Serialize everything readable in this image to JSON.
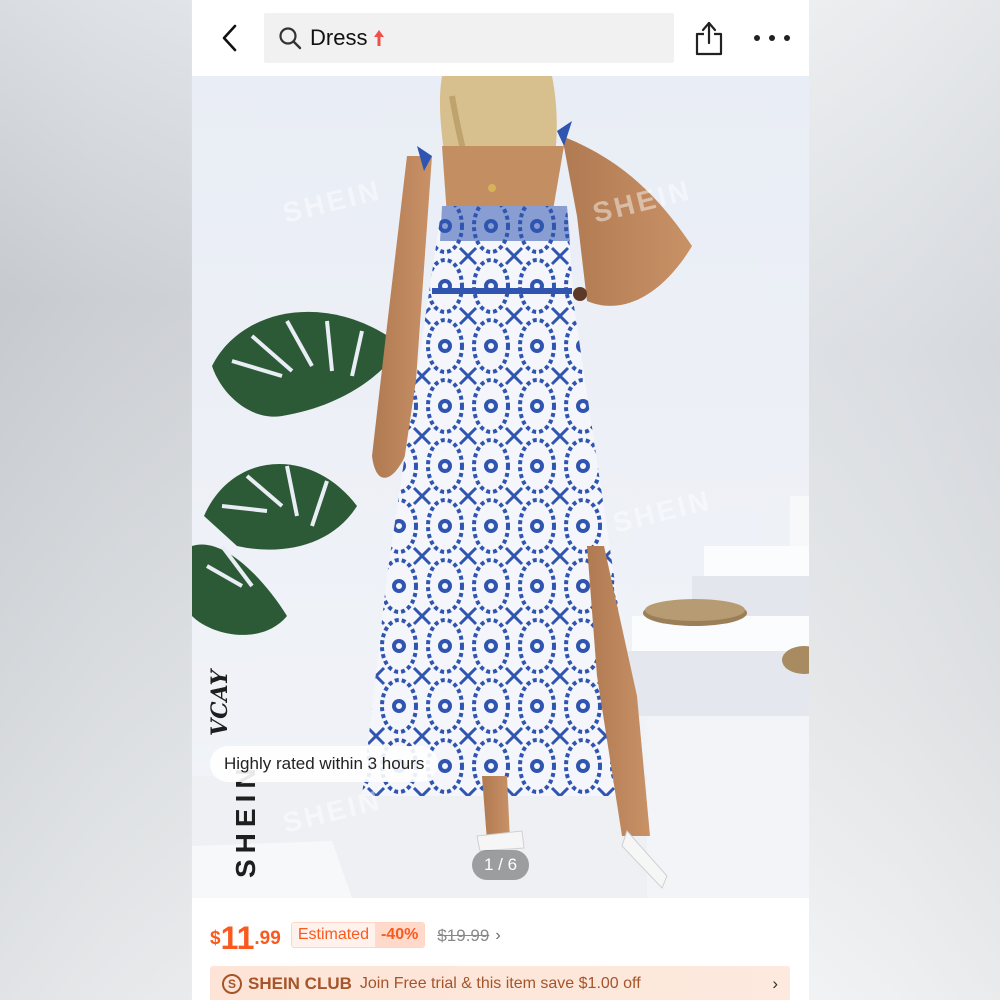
{
  "search": {
    "query": "Dress"
  },
  "gallery": {
    "watermark": "SHEIN",
    "brand_main": "SHEIN",
    "brand_script": "VCAY",
    "rating_badge": "Highly rated within 3 hours",
    "pager": "1 / 6"
  },
  "price": {
    "currency": "$",
    "integer": "11",
    "decimal": ".99",
    "estimated_label": "Estimated",
    "discount": "-40%",
    "original": "$19.99",
    "original_chevron": "›"
  },
  "club": {
    "logo_letter": "S",
    "name": "SHEIN CLUB",
    "description": "Join Free trial & this item save $1.00 off",
    "chevron": "›"
  },
  "colors": {
    "accent": "#fa5a1e",
    "club_text": "#a6542a",
    "dress_blue": "#2f55b0"
  },
  "icons": [
    "back-arrow-icon",
    "search-icon",
    "trend-up-icon",
    "share-icon",
    "more-icon",
    "chevron-right-icon"
  ]
}
